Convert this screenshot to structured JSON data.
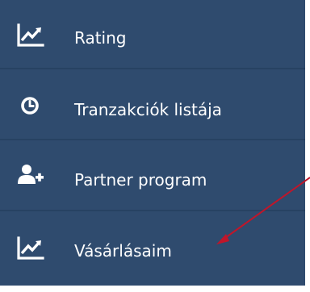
{
  "menu": {
    "items": [
      {
        "label": "Rating",
        "icon": "chart-line-icon"
      },
      {
        "label": "Tranzakciók listája",
        "icon": "clock-icon"
      },
      {
        "label": "Partner program",
        "icon": "user-plus-icon"
      },
      {
        "label": "Vásárlásaim",
        "icon": "chart-line-icon"
      }
    ]
  },
  "colors": {
    "sidebar_bg": "#2f4b6e",
    "separator": "#274262",
    "text": "#ffffff",
    "annotation_arrow": "#c0162a"
  }
}
